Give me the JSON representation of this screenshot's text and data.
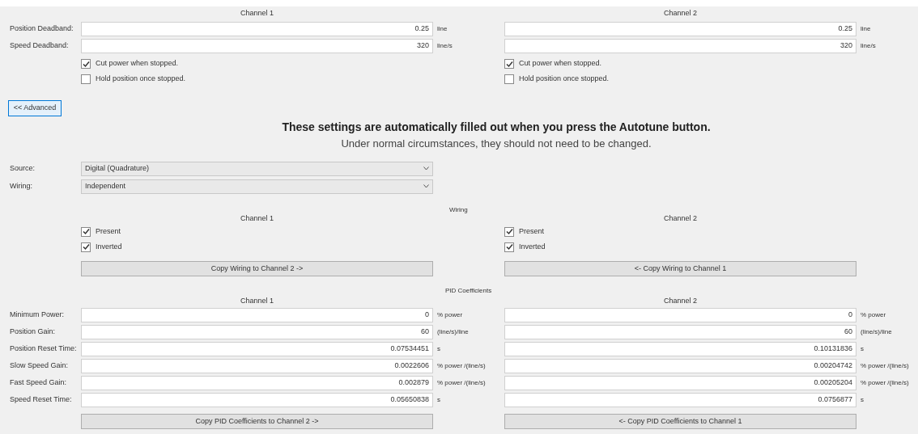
{
  "deadband": {
    "headers": [
      "Channel 1",
      "Channel 2"
    ],
    "rows": [
      {
        "label": "Position Deadband:",
        "cells": [
          {
            "value": "0.25",
            "unit": "line"
          },
          {
            "value": "0.25",
            "unit": "line"
          }
        ]
      },
      {
        "label": "Speed Deadband:",
        "cells": [
          {
            "value": "320",
            "unit": "line/s"
          },
          {
            "value": "320",
            "unit": "line/s"
          }
        ]
      }
    ],
    "checkboxes": [
      [
        {
          "label": "Cut power when stopped.",
          "checked": true
        },
        {
          "label": "Hold position once stopped.",
          "checked": false
        }
      ],
      [
        {
          "label": "Cut power when stopped.",
          "checked": true
        },
        {
          "label": "Hold position once stopped.",
          "checked": false
        }
      ]
    ]
  },
  "advanced_button": "<< Advanced",
  "notice": {
    "title": "These settings are automatically filled out when you press the Autotune button.",
    "subtitle": "Under normal circumstances, they should not need to be changed."
  },
  "selects": [
    {
      "label": "Source:",
      "value": "Digital (Quadrature)"
    },
    {
      "label": "Wiring:",
      "value": "Independent"
    }
  ],
  "wiring": {
    "title": "Wiring",
    "channels": [
      {
        "title": "Channel 1",
        "checkboxes": [
          {
            "label": "Present",
            "checked": true
          },
          {
            "label": "Inverted",
            "checked": true
          }
        ],
        "button": "Copy Wiring to Channel 2 ->"
      },
      {
        "title": "Channel 2",
        "checkboxes": [
          {
            "label": "Present",
            "checked": true
          },
          {
            "label": "Inverted",
            "checked": true
          }
        ],
        "button": "<- Copy Wiring to Channel 1"
      }
    ]
  },
  "pid": {
    "title": "PID Coefficients",
    "headers": [
      "Channel 1",
      "Channel 2"
    ],
    "rows": [
      {
        "label": "Minimum Power:",
        "cells": [
          {
            "value": "0",
            "unit": "% power"
          },
          {
            "value": "0",
            "unit": "% power"
          }
        ]
      },
      {
        "label": "Position Gain:",
        "cells": [
          {
            "value": "60",
            "unit": "(line/s)/line"
          },
          {
            "value": "60",
            "unit": "(line/s)/line"
          }
        ]
      },
      {
        "label": "Position Reset Time:",
        "cells": [
          {
            "value": "0.07534451",
            "unit": "s"
          },
          {
            "value": "0.10131836",
            "unit": "s"
          }
        ]
      },
      {
        "label": "Slow Speed Gain:",
        "cells": [
          {
            "value": "0.0022606",
            "unit": "% power /(line/s)"
          },
          {
            "value": "0.00204742",
            "unit": "% power /(line/s)"
          }
        ]
      },
      {
        "label": "Fast Speed Gain:",
        "cells": [
          {
            "value": "0.002879",
            "unit": "% power /(line/s)"
          },
          {
            "value": "0.00205204",
            "unit": "% power /(line/s)"
          }
        ]
      },
      {
        "label": "Speed Reset Time:",
        "cells": [
          {
            "value": "0.05650838",
            "unit": "s"
          },
          {
            "value": "0.0756877",
            "unit": "s"
          }
        ]
      }
    ],
    "buttons": [
      "Copy PID Coefficients to Channel 2 ->",
      "<- Copy PID Coefficients to Channel 1"
    ]
  }
}
